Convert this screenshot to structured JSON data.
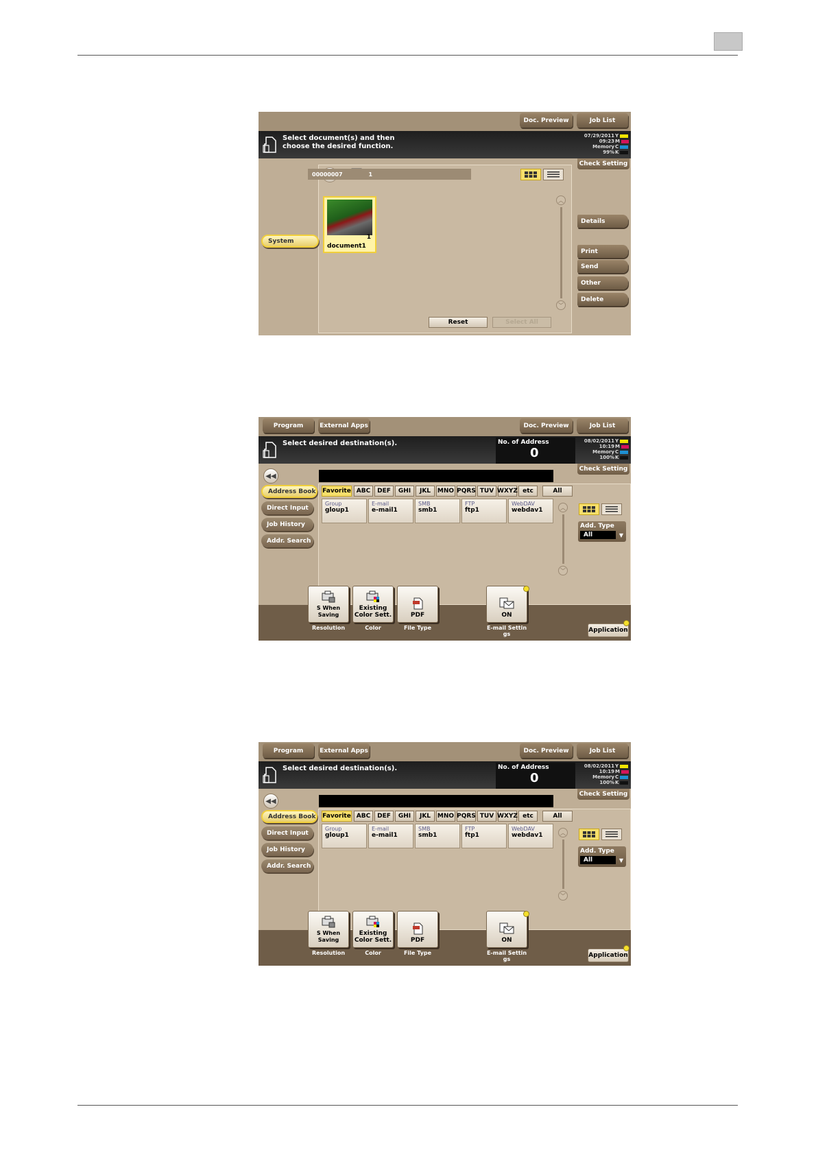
{
  "screen1": {
    "top_buttons": [
      "Doc. Preview",
      "Job List"
    ],
    "message": "Select document(s) and then\nchoose the desired function.",
    "status": "07/29/2011\n09:23\nMemory\n99%",
    "toner": [
      "Y",
      "M",
      "C",
      "K"
    ],
    "check_setting": "Check Setting",
    "side_items": [
      "System"
    ],
    "path_number": "00000007",
    "path_count": "1",
    "document": {
      "name": "document1",
      "pages": "1"
    },
    "right_buttons": [
      "Details",
      "Print",
      "Send",
      "Other",
      "Delete"
    ],
    "reset": "Reset",
    "select_all": "Select All"
  },
  "screen2": {
    "top_buttons": [
      "Program",
      "External Apps",
      "Doc. Preview",
      "Job List"
    ],
    "message": "Select desired destination(s).",
    "no_of_address_label": "No. of Address",
    "no_of_address_value": "0",
    "status": "08/02/2011\n10:19\nMemory\n100%",
    "toner": [
      "Y",
      "M",
      "C",
      "K"
    ],
    "check_setting": "Check Setting",
    "side_items": [
      "Address Book",
      "Direct Input",
      "Job History",
      "Addr. Search"
    ],
    "tabs": [
      "Favorite",
      "ABC",
      "DEF",
      "GHI",
      "JKL",
      "MNO",
      "PQRS",
      "TUV",
      "WXYZ",
      "etc",
      "All"
    ],
    "destinations": [
      {
        "type": "Group",
        "name": "gloup1"
      },
      {
        "type": "E-mail",
        "name": "e-mail1"
      },
      {
        "type": "SMB",
        "name": "smb1"
      },
      {
        "type": "FTP",
        "name": "ftp1"
      },
      {
        "type": "WebDAV",
        "name": "webdav1"
      }
    ],
    "add_type_label": "Add. Type",
    "add_type_value": "All",
    "functions": [
      {
        "value": "S When\nSaving",
        "label": "Resolution"
      },
      {
        "value": "Existing\nColor Sett.",
        "label": "Color"
      },
      {
        "value": "PDF",
        "label": "File Type"
      },
      {
        "value": "ON",
        "label": "E-mail Settin\ngs"
      }
    ],
    "application": "Application"
  },
  "screen3": {
    "top_buttons": [
      "Program",
      "External Apps",
      "Doc. Preview",
      "Job List"
    ],
    "message": "Select desired destination(s).",
    "no_of_address_label": "No. of Address",
    "no_of_address_value": "0",
    "status": "08/02/2011\n10:19\nMemory\n100%",
    "toner": [
      "Y",
      "M",
      "C",
      "K"
    ],
    "check_setting": "Check Setting",
    "side_items": [
      "Address Book",
      "Direct Input",
      "Job History",
      "Addr. Search"
    ],
    "tabs": [
      "Favorite",
      "ABC",
      "DEF",
      "GHI",
      "JKL",
      "MNO",
      "PQRS",
      "TUV",
      "WXYZ",
      "etc",
      "All"
    ],
    "destinations": [
      {
        "type": "Group",
        "name": "gloup1"
      },
      {
        "type": "E-mail",
        "name": "e-mail1"
      },
      {
        "type": "SMB",
        "name": "smb1"
      },
      {
        "type": "FTP",
        "name": "ftp1"
      },
      {
        "type": "WebDAV",
        "name": "webdav1"
      }
    ],
    "add_type_label": "Add. Type",
    "add_type_value": "All",
    "functions": [
      {
        "value": "S When\nSaving",
        "label": "Resolution"
      },
      {
        "value": "Existing\nColor Sett.",
        "label": "Color"
      },
      {
        "value": "PDF",
        "label": "File Type"
      },
      {
        "value": "ON",
        "label": "E-mail Settin\ngs"
      }
    ],
    "application": "Application"
  },
  "colors": {
    "toner_y": "#f2e600",
    "toner_m": "#d4145a",
    "toner_c": "#1e8fd2",
    "toner_k": "#111111",
    "highlight": "#f7df6b"
  },
  "icons": [
    "document-icon",
    "up-folder-icon",
    "printer-icon",
    "grid-view-icon",
    "list-view-icon",
    "scroll-up-icon",
    "scroll-down-icon",
    "back-icon",
    "resolution-icon",
    "color-icon",
    "pdf-icon",
    "email-icon"
  ]
}
